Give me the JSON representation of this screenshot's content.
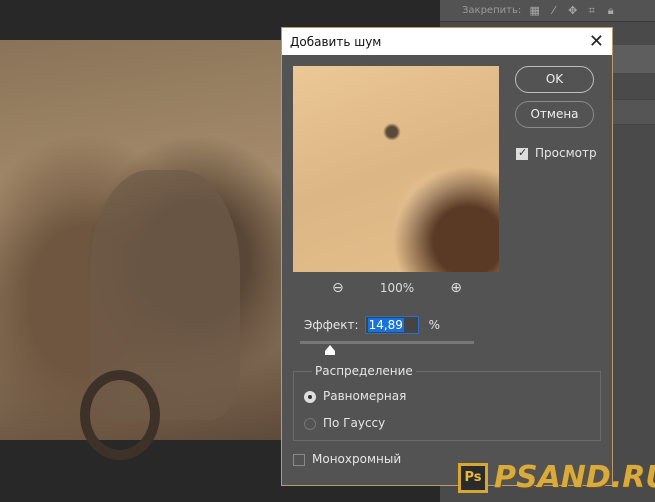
{
  "panel": {
    "lock_label": "Закрепить:",
    "lock_icons": [
      "transparency-lock-icon",
      "brush-icon",
      "move-icon",
      "artboard-icon",
      "lock-icon"
    ]
  },
  "dialog": {
    "title": "Добавить шум",
    "ok": "OK",
    "cancel": "Отмена",
    "preview_label": "Просмотр",
    "preview_checked": true,
    "zoom_level": "100%",
    "effect_label": "Эффект:",
    "effect_value": "14,89",
    "effect_unit": "%",
    "distribution": {
      "legend": "Распределение",
      "options": [
        {
          "label": "Равномерная",
          "selected": true
        },
        {
          "label": "По Гауссу",
          "selected": false
        }
      ]
    },
    "monochrome_label": "Монохромный",
    "monochrome_checked": false
  },
  "watermark": {
    "badge": "Ps",
    "text": "PSAND.RU"
  }
}
